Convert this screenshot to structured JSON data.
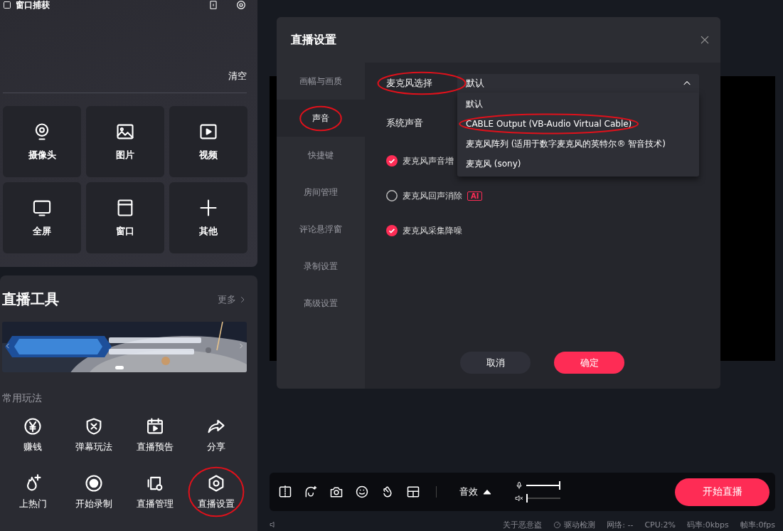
{
  "capture_source": {
    "label": "窗口捕获"
  },
  "clear_button": "清空",
  "sources": [
    {
      "label": "摄像头"
    },
    {
      "label": "图片"
    },
    {
      "label": "视频"
    },
    {
      "label": "全屏"
    },
    {
      "label": "窗口"
    },
    {
      "label": "其他"
    }
  ],
  "live_tools": {
    "title": "直播工具",
    "more": "更多",
    "section_label": "常用玩法",
    "tools": [
      {
        "label": "赚钱",
        "circled": false
      },
      {
        "label": "弹幕玩法",
        "circled": false
      },
      {
        "label": "直播预告",
        "circled": false
      },
      {
        "label": "分享",
        "circled": false
      },
      {
        "label": "上热门",
        "circled": false
      },
      {
        "label": "开始录制",
        "circled": false
      },
      {
        "label": "直播管理",
        "circled": false
      },
      {
        "label": "直播设置",
        "circled": true
      }
    ]
  },
  "dialog": {
    "title": "直播设置",
    "nav": [
      {
        "label": "画幅与画质",
        "selected": false,
        "circled": false
      },
      {
        "label": "声音",
        "selected": true,
        "circled": true
      },
      {
        "label": "快捷键",
        "selected": false,
        "circled": false
      },
      {
        "label": "房间管理",
        "selected": false,
        "circled": false
      },
      {
        "label": "评论悬浮窗",
        "selected": false,
        "circled": false
      },
      {
        "label": "录制设置",
        "selected": false,
        "circled": false
      },
      {
        "label": "高级设置",
        "selected": false,
        "circled": false
      }
    ],
    "mic_select": {
      "label": "麦克风选择",
      "circled": true,
      "value": "默认",
      "expanded": true,
      "options": [
        {
          "label": "默认",
          "circled": false
        },
        {
          "label": "CABLE Output (VB-Audio Virtual Cable)",
          "circled": true
        },
        {
          "label": "麦克风阵列 (适用于数字麦克风的英特尔® 智音技术)",
          "circled": false
        },
        {
          "label": "麦克风 (sony)",
          "circled": false
        }
      ]
    },
    "system_sound": {
      "label": "系统声音"
    },
    "options": [
      {
        "label": "麦克风声音增",
        "checked": true
      },
      {
        "label": "麦克风回声消除",
        "checked": false,
        "badge": "AI"
      },
      {
        "label": "麦克风采集降噪",
        "checked": true
      }
    ],
    "buttons": [
      {
        "label": "取消",
        "kind": "secondary"
      },
      {
        "label": "确定",
        "kind": "primary"
      }
    ]
  },
  "toolbar": {
    "effects": "音效",
    "mic": {
      "level": 1
    },
    "speaker": {
      "level": 0,
      "muted": true
    },
    "start_button": "开始直播"
  },
  "status_bar": [
    "关于恶意盗",
    "驱动检测",
    "网络: --",
    "CPU:2%",
    "码率:0kbps",
    "帧率:0fps"
  ]
}
